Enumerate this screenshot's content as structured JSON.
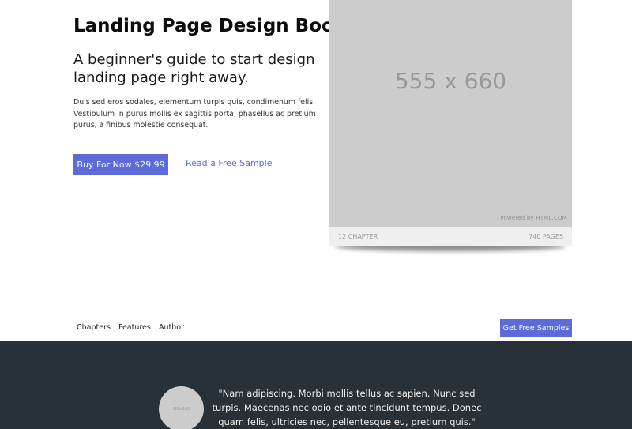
{
  "hero": {
    "title": "Landing Page Design Book",
    "subtitle": "A beginner's guide to start design landing page right away.",
    "body": "Duis sed eros sodales, elementum turpis quis, condimenum felis. Vestibulum in purus mollis ex sagittis porta, phasellus ac pretium purus, a finibus molestie consequat.",
    "buy_label": "Buy For Now $29.99",
    "sample_label": "Read a Free Sample"
  },
  "book": {
    "placeholder_text": "555 x 660",
    "powered_text": "Powered by HTML.COM",
    "chapters": "12 CHAPTER",
    "pages": "740 PAGES"
  },
  "nav": {
    "items": [
      {
        "label": "Chapters"
      },
      {
        "label": "Features"
      },
      {
        "label": "Author"
      }
    ],
    "cta_label": "Get Free Samples"
  },
  "testimonial": {
    "avatar_text": "100x100",
    "quote": "\"Nam adipiscing. Morbi mollis tellus ac sapien. Nunc sed turpis. Maecenas nec odio et ante tincidunt tempus. Donec quam felis, ultricies nec, pellentesque eu, pretium quis.\""
  },
  "colors": {
    "accent": "#5c6bd8",
    "dark_section": "#283138",
    "placeholder_gray": "#cccccc"
  }
}
